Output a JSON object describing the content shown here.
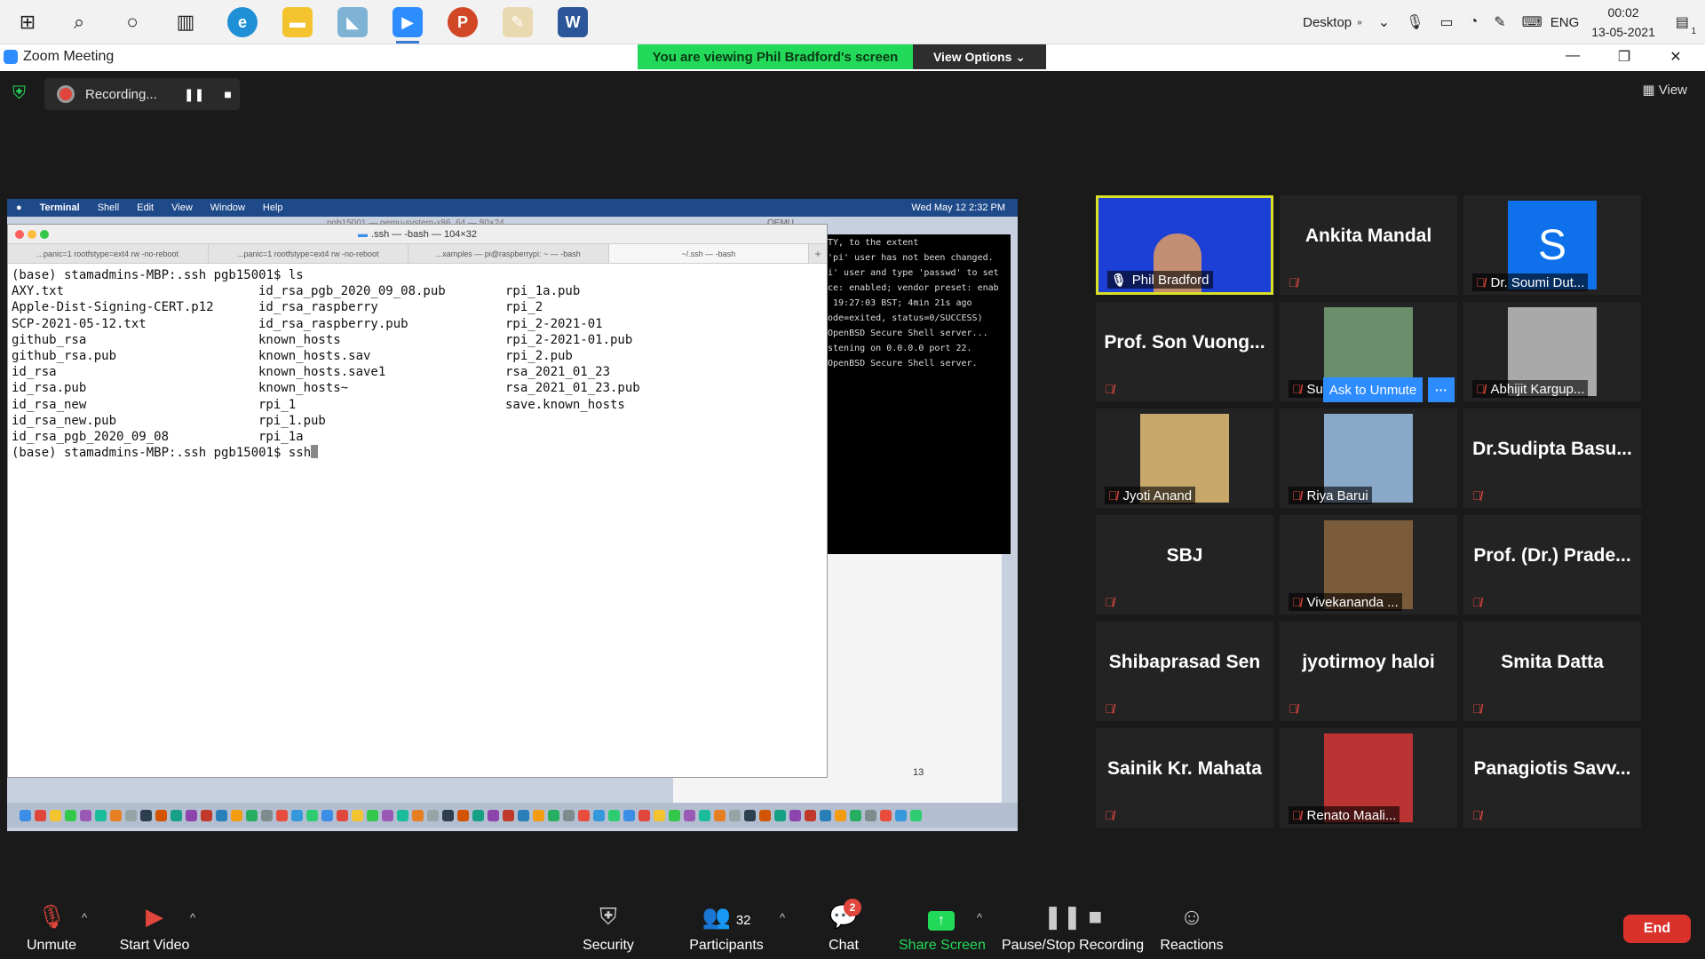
{
  "taskbar": {
    "tray_desktop": "Desktop",
    "tray_lang": "ENG",
    "time": "00:02",
    "date": "13-05-2021",
    "notif_count": "1"
  },
  "titlebar": {
    "title": "Zoom Meeting",
    "viewing_banner": "You are viewing Phil Bradford's screen",
    "view_options": "View Options ⌄"
  },
  "meeting": {
    "recording_label": "Recording...",
    "view_label": "View"
  },
  "shared_screen": {
    "mac_menu": [
      "Terminal",
      "Shell",
      "Edit",
      "View",
      "Window",
      "Help"
    ],
    "mac_clock": "Wed May 12  2:32 PM",
    "terminal_title": "pgb15001 — qemu-system-x86_64 — 80×24",
    "terminal_inner_title": ".ssh — -bash — 104×32",
    "tabs": [
      "...panic=1 rootfstype=ext4 rw -no-reboot",
      "...panic=1 rootfstype=ext4 rw -no-reboot",
      "...xamples — pi@raspberrypi: ~ — -bash",
      "~/.ssh — -bash"
    ],
    "prompt_ls": "(base) stamadmins-MBP:.ssh pgb15001$ ls",
    "prompt_ssh": "(base) stamadmins-MBP:.ssh pgb15001$ ssh",
    "ls_rows": [
      [
        "AXY.txt",
        "id_rsa_pgb_2020_09_08.pub",
        "rpi_1a.pub"
      ],
      [
        "Apple-Dist-Signing-CERT.p12",
        "id_rsa_raspberry",
        "rpi_2"
      ],
      [
        "SCP-2021-05-12.txt",
        "id_rsa_raspberry.pub",
        "rpi_2-2021-01"
      ],
      [
        "github_rsa",
        "known_hosts",
        "rpi_2-2021-01.pub"
      ],
      [
        "github_rsa.pub",
        "known_hosts.sav",
        "rpi_2.pub"
      ],
      [
        "id_rsa",
        "known_hosts.save1",
        "rsa_2021_01_23"
      ],
      [
        "id_rsa.pub",
        "known_hosts~",
        "rsa_2021_01_23.pub"
      ],
      [
        "id_rsa_new",
        "rpi_1",
        "save.known_hosts"
      ],
      [
        "id_rsa_new.pub",
        "rpi_1.pub",
        ""
      ],
      [
        "id_rsa_pgb_2020_09_08",
        "rpi_1a",
        ""
      ]
    ],
    "qemu_label": "QEMU",
    "qemu_lines": [
      "TY, to the extent",
      "",
      "'pi' user has not been changed.",
      "i' user and type 'passwd' to set",
      "",
      "ce: enabled; vendor preset: enab",
      " 19:27:03 BST; 4min 21s ago",
      "",
      "ode=exited, status=0/SUCCESS)",
      "",
      "OpenBSD Secure Shell server...",
      "stening on 0.0.0.0 port 22.",
      "OpenBSD Secure Shell server."
    ],
    "page_number": "13"
  },
  "gallery": {
    "ask_to_unmute": "Ask to Unmute",
    "more": "···",
    "tiles": [
      {
        "name": "Phil Bradford",
        "type": "video"
      },
      {
        "name": "Ankita Mandal",
        "type": "name"
      },
      {
        "name": "Dr. Soumi Dut...",
        "type": "avatar",
        "avatar_letter": "S"
      },
      {
        "name": "Prof. Son Vuong...",
        "type": "name"
      },
      {
        "name": "Subhabrata S...",
        "type": "photo"
      },
      {
        "name": "Abhijit Kargup...",
        "type": "photo"
      },
      {
        "name": "Jyoti Anand",
        "type": "photo"
      },
      {
        "name": "Riya Barui",
        "type": "photo"
      },
      {
        "name": "Dr.Sudipta Basu...",
        "type": "name"
      },
      {
        "name": "SBJ",
        "type": "name"
      },
      {
        "name": "Vivekananda ...",
        "type": "photo"
      },
      {
        "name": "Prof. (Dr.) Prade...",
        "type": "name"
      },
      {
        "name": "Shibaprasad Sen",
        "type": "name"
      },
      {
        "name": "jyotirmoy haloi",
        "type": "name"
      },
      {
        "name": "Smita Datta",
        "type": "name"
      },
      {
        "name": "Sainik Kr. Mahata",
        "type": "name"
      },
      {
        "name": "Renato Maali...",
        "type": "photo"
      },
      {
        "name": "Panagiotis Savv...",
        "type": "name"
      }
    ]
  },
  "controls": {
    "unmute": "Unmute",
    "start_video": "Start Video",
    "security": "Security",
    "participants": "Participants",
    "participants_count": "32",
    "chat": "Chat",
    "chat_badge": "2",
    "share_screen": "Share Screen",
    "pause_stop_recording": "Pause/Stop Recording",
    "reactions": "Reactions",
    "end": "End"
  },
  "colors": {
    "banner_green": "#23d959",
    "zoom_blue": "#2d8cff",
    "end_red": "#d9322b",
    "speaker_border": "#d9e026"
  }
}
